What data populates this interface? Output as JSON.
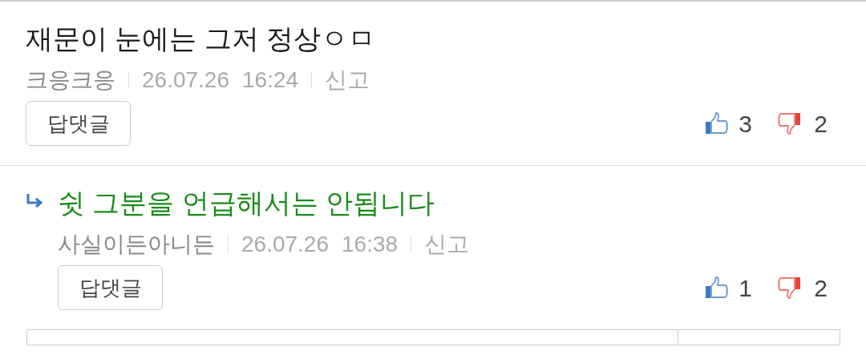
{
  "comments": [
    {
      "kind": "comment",
      "text": "재문이 눈에는 그저 정상ㅇㅁ",
      "author": "크응크응",
      "date": "26.07.26",
      "time": "16:24",
      "report": "신고",
      "reply_button": "답댓글",
      "likes": "3",
      "dislikes": "2"
    },
    {
      "kind": "reply",
      "text": "쉿 그분을 언급해서는 안됩니다",
      "author": "사실이든아니든",
      "date": "26.07.26",
      "time": "16:38",
      "report": "신고",
      "reply_button": "답댓글",
      "likes": "1",
      "dislikes": "2"
    }
  ]
}
